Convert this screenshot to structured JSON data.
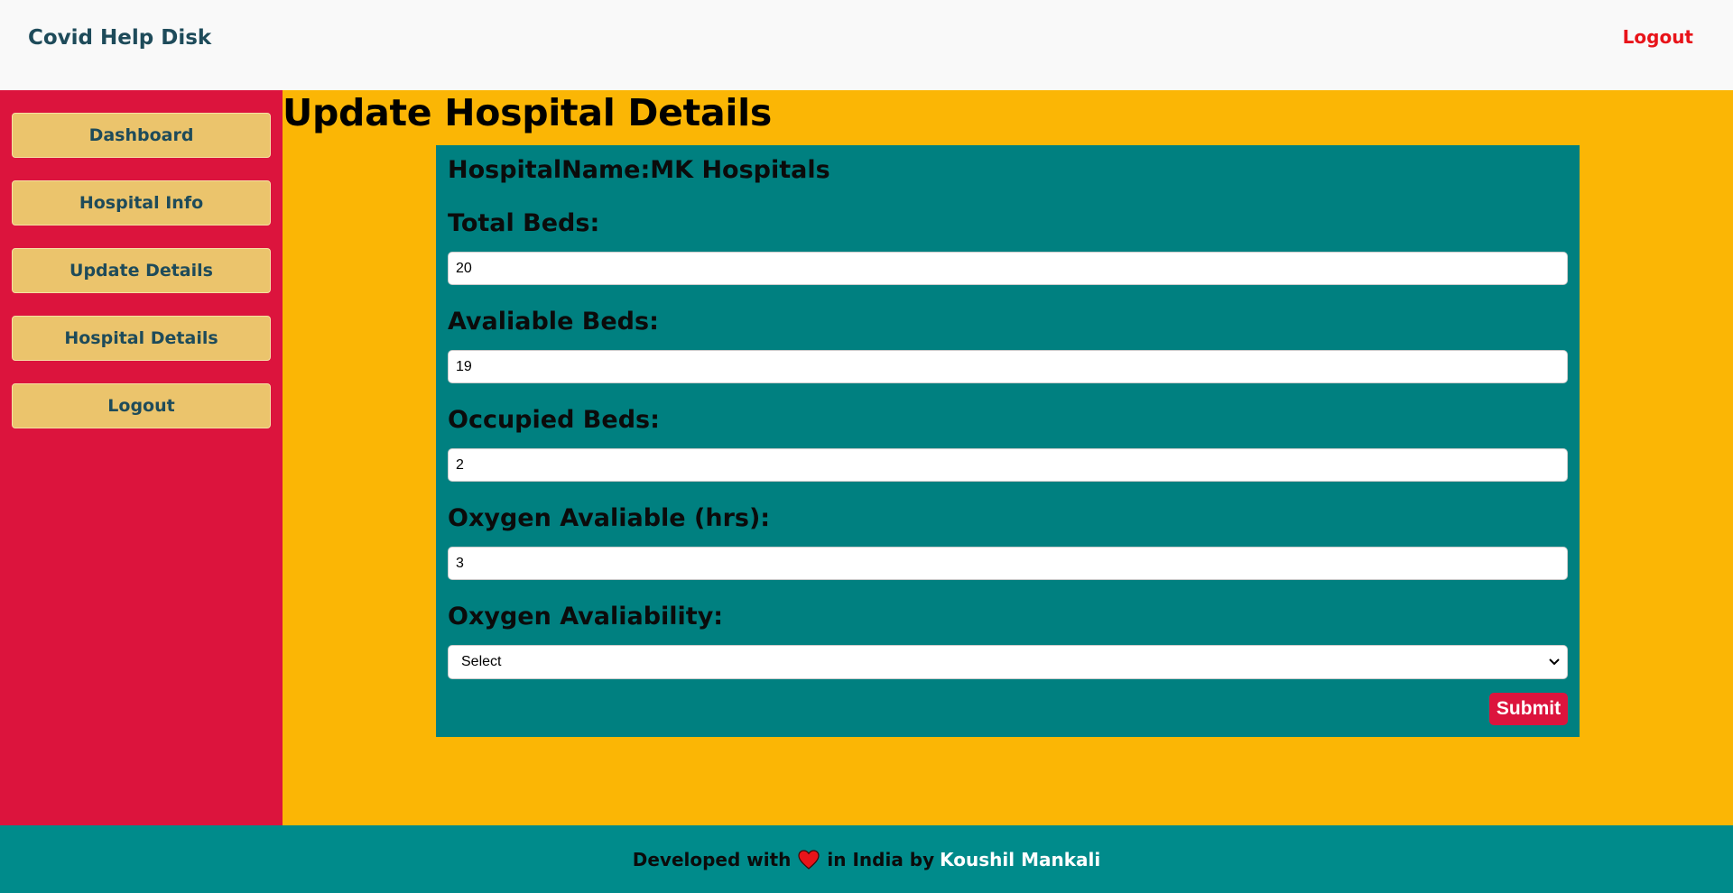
{
  "header": {
    "brand": "Covid Help Disk",
    "logout_label": "Logout"
  },
  "sidebar": {
    "items": [
      {
        "label": "Dashboard"
      },
      {
        "label": "Hospital Info"
      },
      {
        "label": "Update Details"
      },
      {
        "label": "Hospital Details"
      },
      {
        "label": "Logout"
      }
    ]
  },
  "main": {
    "title": "Update Hospital Details",
    "hospital_name_prefix": "HospitalName:",
    "hospital_name": "MK Hospitals",
    "fields": [
      {
        "label": "Total Beds:",
        "value": "20"
      },
      {
        "label": "Avaliable Beds:",
        "value": "19"
      },
      {
        "label": "Occupied Beds:",
        "value": "2"
      },
      {
        "label": "Oxygen Avaliable (hrs):",
        "value": "3"
      }
    ],
    "oxygen_availability": {
      "label": "Oxygen Avaliability:",
      "selected": "Select"
    },
    "submit_label": "Submit"
  },
  "footer": {
    "prefix": "Developed with",
    "middle": "in India by",
    "author": "Koushil Mankali",
    "heart_color": "#e8141a",
    "heart_icon": "heart-icon"
  },
  "colors": {
    "topbar_bg": "#f9f9f9",
    "sidebar_bg": "#dc143d",
    "main_bg": "#fbb605",
    "card_bg": "#008080",
    "footer_bg": "#008b8b",
    "sidebar_button_bg": "#ebc46c",
    "submit_bg": "#dc143d"
  }
}
